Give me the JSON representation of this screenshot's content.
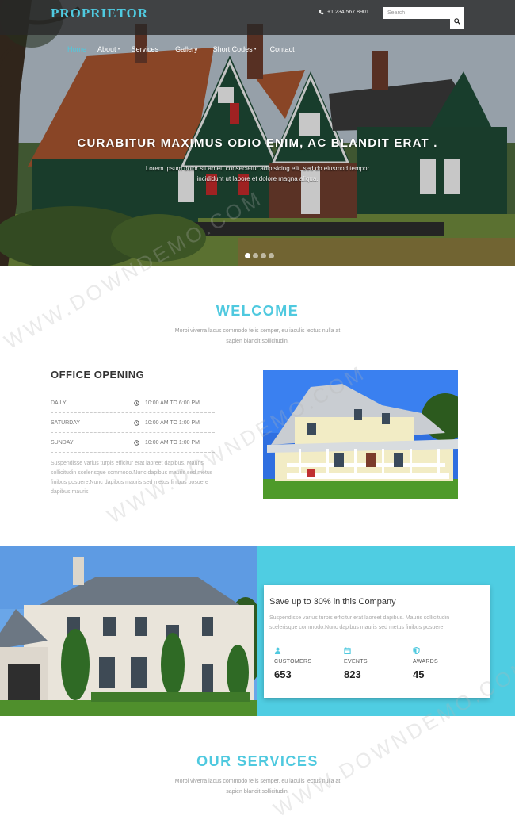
{
  "header": {
    "logo": "PROPRIETOR",
    "phone": "+1 234 567 8901",
    "search_placeholder": "Search"
  },
  "nav": {
    "items": [
      {
        "label": "Home",
        "active": true
      },
      {
        "label": "About",
        "dropdown": true
      },
      {
        "label": "Services"
      },
      {
        "label": "Gallery"
      },
      {
        "label": "Short Codes",
        "dropdown": true
      },
      {
        "label": "Contact"
      }
    ]
  },
  "hero": {
    "title": "CURABITUR MAXIMUS ODIO ENIM, AC BLANDIT ERAT .",
    "text": "Lorem ipsum dolor sit amet, consectetur adipisicing elit, sed do eiusmod tempor incididunt ut labore et dolore magna aliqua.",
    "slides": 4,
    "active_slide": 1
  },
  "welcome": {
    "title": "WELCOME",
    "text": "Morbi viverra lacus commodo felis semper, eu iaculis lectus nulla at sapien blandit sollicitudin."
  },
  "office": {
    "title": "OFFICE OPENING",
    "hours": [
      {
        "day": "DAILY",
        "time": "10:00 AM TO 6:00 PM"
      },
      {
        "day": "SATURDAY",
        "time": "10:00 AM TO 1:00 PM"
      },
      {
        "day": "SUNDAY",
        "time": "10:00 AM TO 1:00 PM"
      }
    ],
    "text": "Suspendisse varius turpis efficitur erat laoreet dapibus. Mauris sollicitudin scelerisque commodo.Nunc dapibus mauris sed metus finibus posuere.Nunc dapibus mauris sed metus finibus posuere dapibus mauris"
  },
  "promo": {
    "title": "Save up to 30% in this Company",
    "text": "Suspendisse varius turpis efficitur erat laoreet dapibus. Mauris sollicitudin scelerisque commodo.Nunc dapibus mauris sed metus finibus posuere.",
    "stats": [
      {
        "icon": "user-icon",
        "label": "CUSTOMERS",
        "value": "653"
      },
      {
        "icon": "calendar-icon",
        "label": "EVENTS",
        "value": "823"
      },
      {
        "icon": "shield-icon",
        "label": "AWARDS",
        "value": "45"
      }
    ]
  },
  "services": {
    "title": "OUR SERVICES",
    "text": "Morbi viverra lacus commodo felis semper, eu iaculis lectus nulla at sapien blandit sollicitudin."
  },
  "watermark": "WWW.DOWNDEMO.COM",
  "colors": {
    "accent": "#4fc9df",
    "band": "#4fcde2",
    "topbar": "#2f2f2f"
  }
}
